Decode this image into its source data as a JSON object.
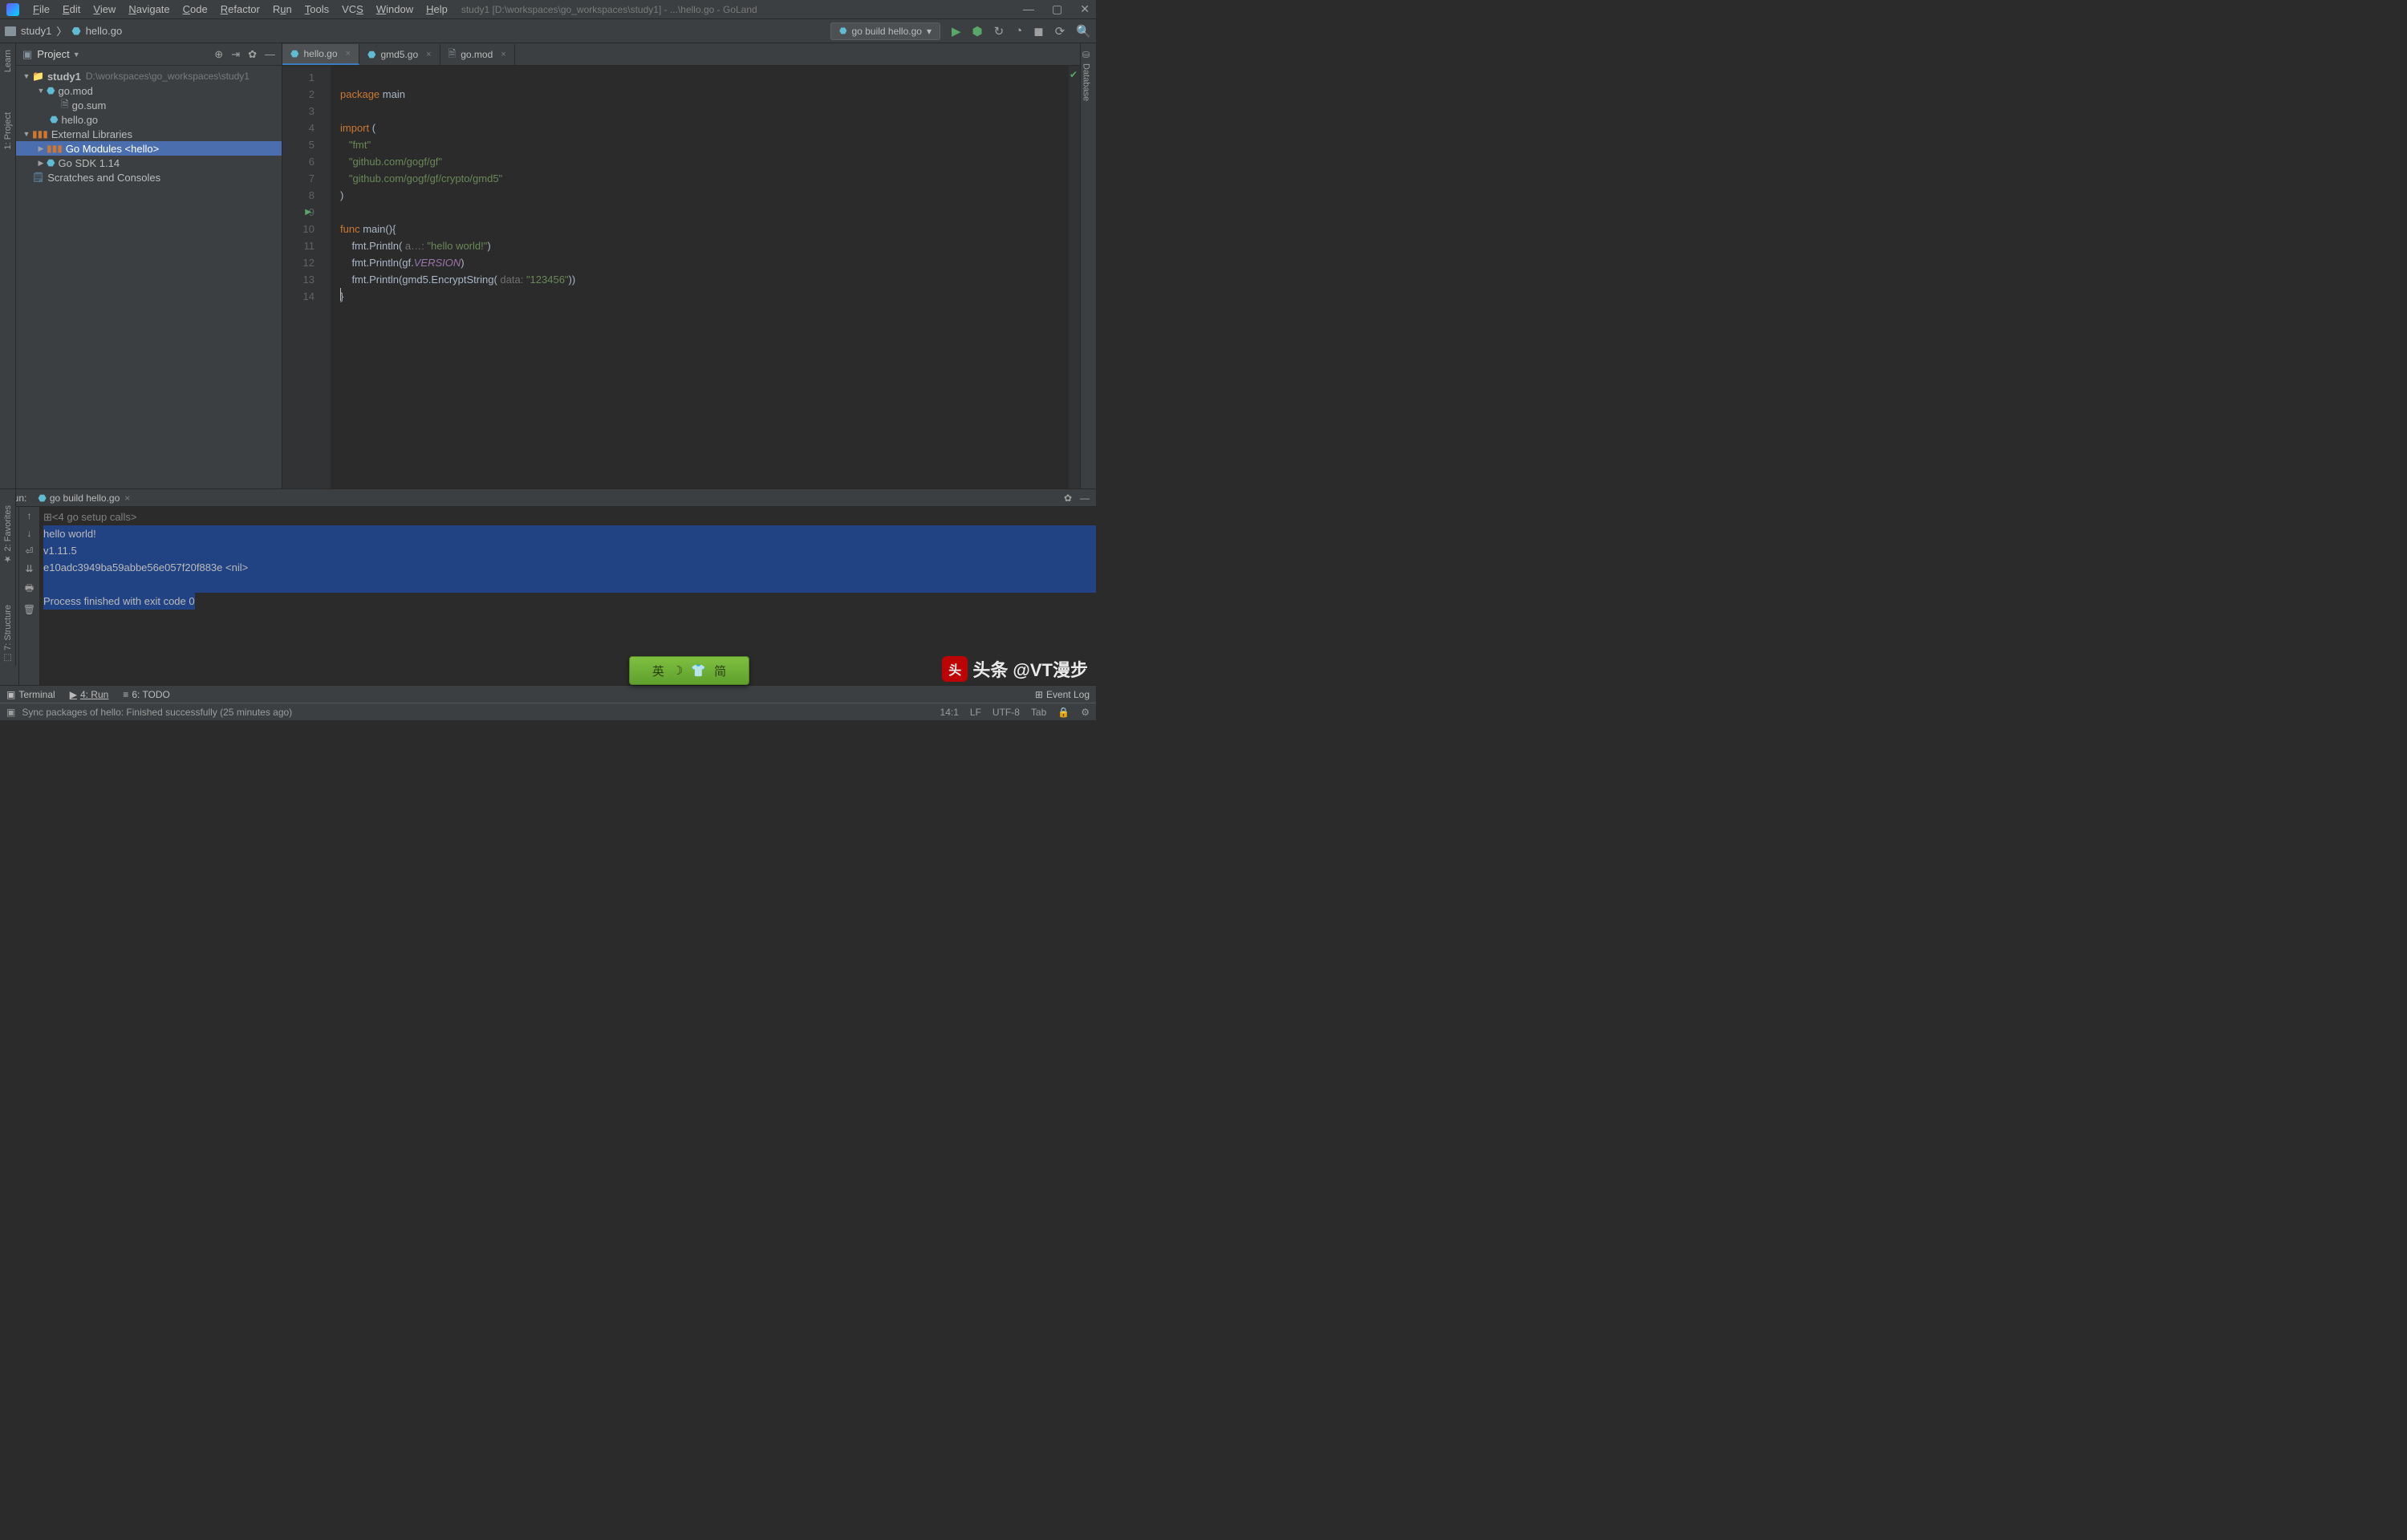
{
  "title": "study1 [D:\\workspaces\\go_workspaces\\study1] - ...\\hello.go - GoLand",
  "menus": [
    "File",
    "Edit",
    "View",
    "Navigate",
    "Code",
    "Refactor",
    "Run",
    "Tools",
    "VCS",
    "Window",
    "Help"
  ],
  "breadcrumb": {
    "root": "study1",
    "file": "hello.go"
  },
  "run_config": "go build hello.go",
  "sidebar_left": [
    "Learn",
    "1: Project"
  ],
  "sidebar_left2": [
    "2: Favorites",
    "7: Structure"
  ],
  "sidebar_right": [
    "Database"
  ],
  "project": {
    "title": "Project",
    "tree": {
      "root": {
        "name": "study1",
        "path": "D:\\workspaces\\go_workspaces\\study1"
      },
      "gomod": "go.mod",
      "gosum": "go.sum",
      "hellogo": "hello.go",
      "extlib": "External Libraries",
      "gomodules": "Go Modules <hello>",
      "gosdk": "Go SDK 1.14",
      "scratches": "Scratches and Consoles"
    }
  },
  "tabs": [
    {
      "name": "hello.go",
      "active": true
    },
    {
      "name": "gmd5.go",
      "active": false
    },
    {
      "name": "go.mod",
      "active": false
    }
  ],
  "code": {
    "l1": {
      "kw": "package ",
      "id": "main"
    },
    "l3": {
      "kw": "import ",
      "p": "("
    },
    "l4": "   \"fmt\"",
    "l5": "   \"github.com/gogf/gf\"",
    "l6": "   \"github.com/gogf/gf/crypto/gmd5\"",
    "l7": ")",
    "l9": {
      "kw": "func ",
      "id": "main",
      "rest": "(){"
    },
    "l10": {
      "pre": "    fmt.Println( ",
      "hint": "a…: ",
      "str": "\"hello world!\"",
      "post": ")"
    },
    "l11": {
      "pre": "    fmt.Println(gf.",
      "prop": "VERSION",
      "post": ")"
    },
    "l12": {
      "pre": "    fmt.Println(gmd5.EncryptString( ",
      "hint": "data: ",
      "str": "\"123456\"",
      "post": "))"
    },
    "l13": "}"
  },
  "run": {
    "label": "Run:",
    "config": "go build hello.go",
    "output": {
      "setup": "<4 go setup calls>",
      "l1": "hello world!",
      "l2": "v1.11.5",
      "l3": "e10adc3949ba59abbe56e057f20f883e <nil>",
      "l4": "",
      "l5": "Process finished with exit code 0"
    }
  },
  "bottom_tabs": {
    "terminal": "Terminal",
    "run": "4: Run",
    "todo": "6: TODO",
    "eventlog": "Event Log"
  },
  "status": {
    "msg": "Sync packages of hello: Finished successfully (25 minutes ago)",
    "pos": "14:1",
    "lf": "LF",
    "enc": "UTF-8",
    "tab": "Tab"
  },
  "ime": {
    "t1": "英",
    "t2": "简"
  },
  "watermark": "头条 @VT漫步"
}
